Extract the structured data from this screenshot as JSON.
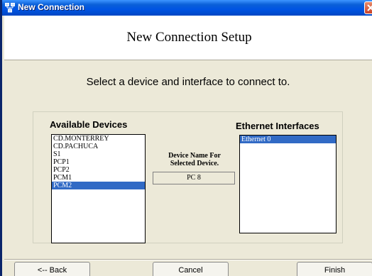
{
  "window": {
    "title": "New Connection"
  },
  "header": {
    "title": "New Connection Setup"
  },
  "main": {
    "instruction": "Select a device and interface to connect to.",
    "available_devices": {
      "label": "Available Devices",
      "items": [
        "CD.MONTERREY",
        "CD.PACHUCA",
        "S1",
        "PCP1",
        "PCP2",
        "PCM1",
        "PCM2"
      ],
      "selected": "PCM2"
    },
    "device_name": {
      "label_line1": "Device Name For",
      "label_line2": "Selected Device.",
      "value": "PC 8"
    },
    "ethernet_interfaces": {
      "label": "Ethernet Interfaces",
      "items": [
        "Ethernet 0"
      ],
      "selected": "Ethernet 0"
    }
  },
  "footer": {
    "back_label": "<-- Back",
    "cancel_label": "Cancel",
    "finish_label": "Finish"
  },
  "colors": {
    "titlebar": "#0054e3",
    "selection": "#316ac5",
    "dialog_bg": "#ece9d8"
  }
}
